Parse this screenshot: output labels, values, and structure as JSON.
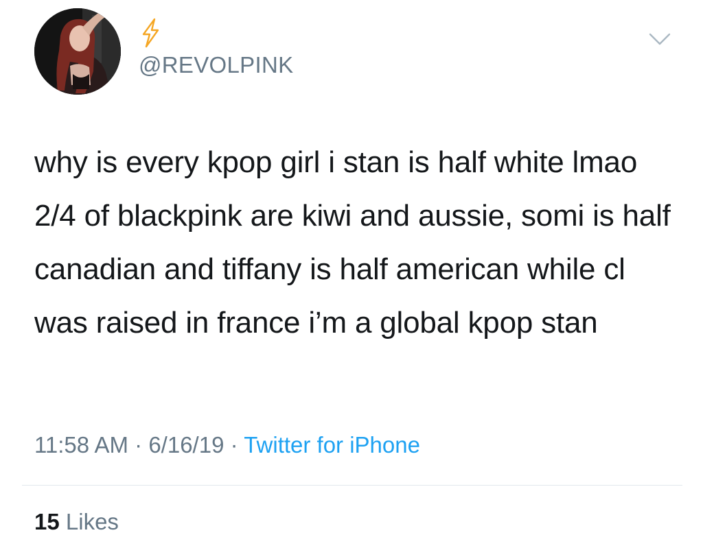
{
  "user": {
    "handle": "@REVOLPINK",
    "name_icon": "lightning-bolt-icon",
    "avatar": "profile-photo"
  },
  "tweet": {
    "text": "why is every kpop girl i stan is half white lmao 2/4 of blackpink are kiwi and aussie, somi is half canadian and tiffany is half american while cl was raised in france i’m a global kpop stan",
    "time": "11:58 AM",
    "date": "6/16/19",
    "separator": "·",
    "source": "Twitter for iPhone"
  },
  "stats": {
    "likes_count": "15",
    "likes_label": "Likes"
  },
  "menu": {
    "caret_icon": "chevron-down-icon"
  },
  "colors": {
    "text": "#14171a",
    "secondary": "#657786",
    "link": "#1da1f2",
    "divider": "#e1e8ed",
    "emoji": "#f5a623"
  }
}
